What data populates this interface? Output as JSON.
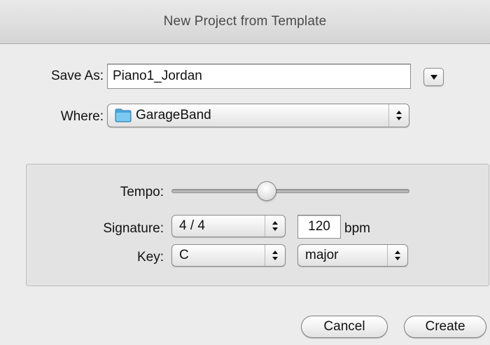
{
  "dialog": {
    "title": "New Project from Template"
  },
  "save_as": {
    "label": "Save As:",
    "value": "Piano1_Jordan"
  },
  "where": {
    "label": "Where:",
    "value": "GarageBand",
    "icon": "folder-icon",
    "folder_color": "#5fb6e6"
  },
  "tempo": {
    "label": "Tempo:",
    "value": 120
  },
  "signature": {
    "label": "Signature:",
    "value": "4 / 4"
  },
  "bpm": {
    "value": "120",
    "unit": "bpm"
  },
  "key": {
    "label": "Key:",
    "note": "C",
    "mode": "major"
  },
  "buttons": {
    "cancel": "Cancel",
    "create": "Create"
  }
}
